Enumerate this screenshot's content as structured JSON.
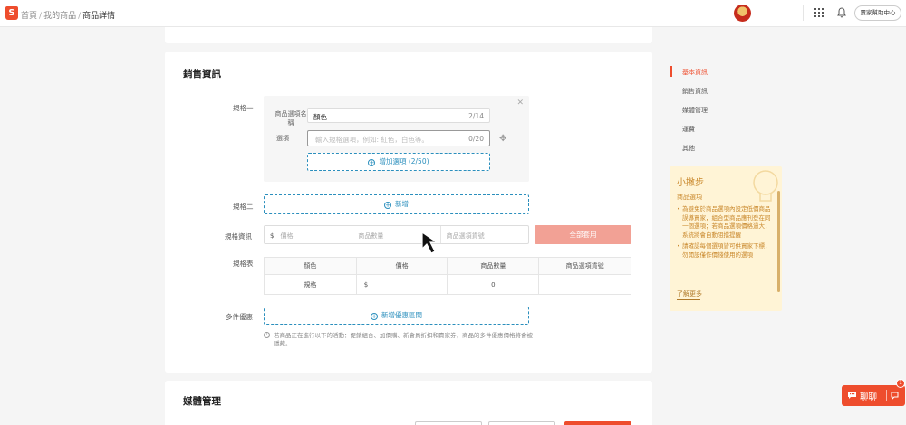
{
  "header": {
    "logo": "S",
    "breadcrumbs": [
      "首頁",
      "我的商品",
      "商品詳情"
    ],
    "help_button": "賣家幫助中心"
  },
  "sales": {
    "title": "銷售資訊",
    "variation1": {
      "label": "規格一",
      "name_label": "商品選項名稱",
      "name_value": "顏色",
      "name_count": "2/14",
      "option_label": "選項",
      "option_placeholder": "輸入規格選項，例如: 紅色，白色等。",
      "option_count": "0/20",
      "add_option": "增加選項 (2/50)"
    },
    "variation2": {
      "label": "規格二",
      "add_label": "新增"
    },
    "spec_info": {
      "label": "規格資訊",
      "currency": "$",
      "price_placeholder": "價格",
      "qty_placeholder": "商品數量",
      "sku_placeholder": "商品選項貨號",
      "apply_all": "全部套用"
    },
    "spec_table": {
      "label": "規格表",
      "headers": [
        "顏色",
        "價格",
        "商品數量",
        "商品選項貨號"
      ],
      "row": {
        "color": "規格",
        "price": "$",
        "qty": "0",
        "sku": ""
      }
    },
    "wholesale": {
      "label": "多件優惠",
      "add_label": "新增優惠區間",
      "note": "若商品正在進行以下的活動：促銷組合、加價購、新會員折扣和賣家券，商品的多件優惠價格將會被隱藏。"
    }
  },
  "media": {
    "title": "媒體管理"
  },
  "nav": {
    "items": [
      "基本資訊",
      "銷售資訊",
      "媒體管理",
      "運費",
      "其他"
    ],
    "active_index": 0
  },
  "tips": {
    "title": "小撇步",
    "subtitle": "商品選項",
    "items": [
      "為避免於商品選項內設定低價商品誤導買家，組合型商品應刊登在同一個選項；若商品選項價格過大，系統將會自動阻擋提醒",
      "請確認每個選項皆可供買家下標，勿開設僅作價錢使用的選項"
    ],
    "more": "了解更多"
  },
  "chat": {
    "label": "聊聊",
    "badge": "1"
  },
  "colors": {
    "brand": "#ee4d2d",
    "link": "#2b8fbd",
    "tip": "#c9872a"
  }
}
